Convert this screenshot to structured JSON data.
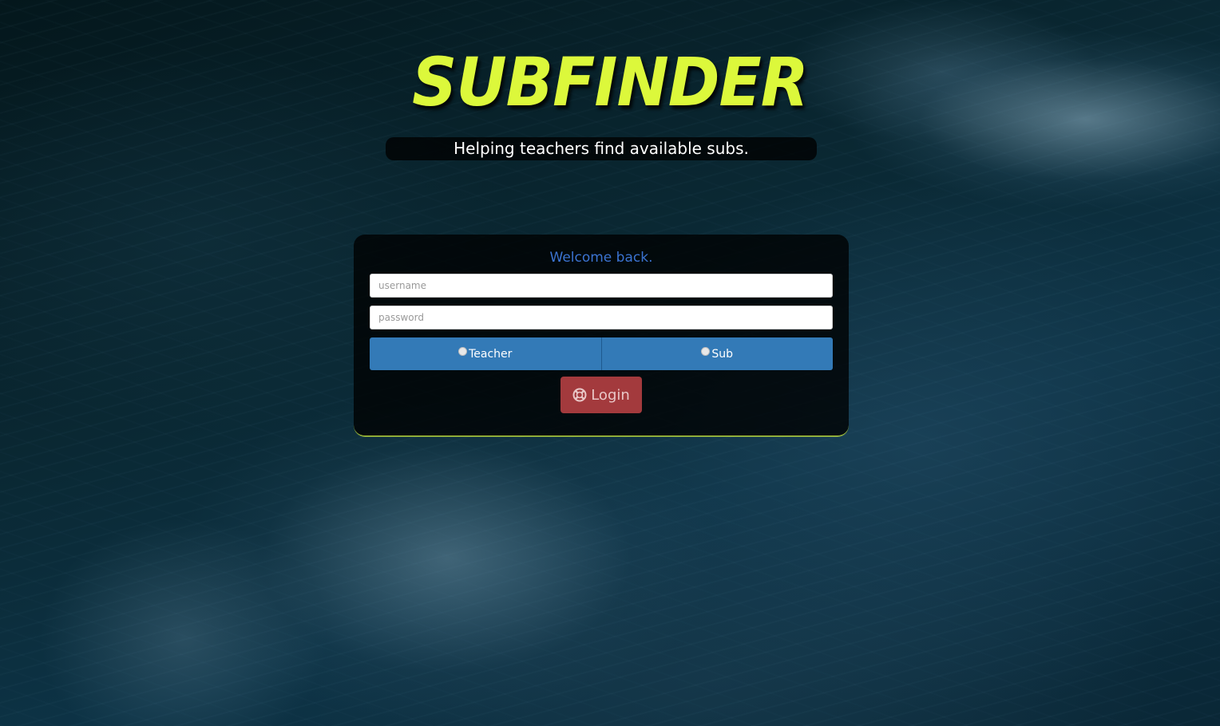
{
  "header": {
    "logo_text": "SUBFINDER",
    "tagline": "Helping teachers find available subs."
  },
  "login_panel": {
    "welcome_text": "Welcome back.",
    "username": {
      "placeholder": "username",
      "value": ""
    },
    "password": {
      "placeholder": "password",
      "value": ""
    },
    "roles": [
      {
        "label": "Teacher",
        "selected": false
      },
      {
        "label": "Sub",
        "selected": false
      }
    ],
    "login_button": {
      "label": "Login",
      "icon": "lifebuoy-icon"
    }
  },
  "colors": {
    "logo": "#dcf83b",
    "welcome_text": "#3b73d1",
    "role_button": "#337ab7",
    "login_button": "#a33a3d",
    "panel_border": "#c8e63a"
  }
}
